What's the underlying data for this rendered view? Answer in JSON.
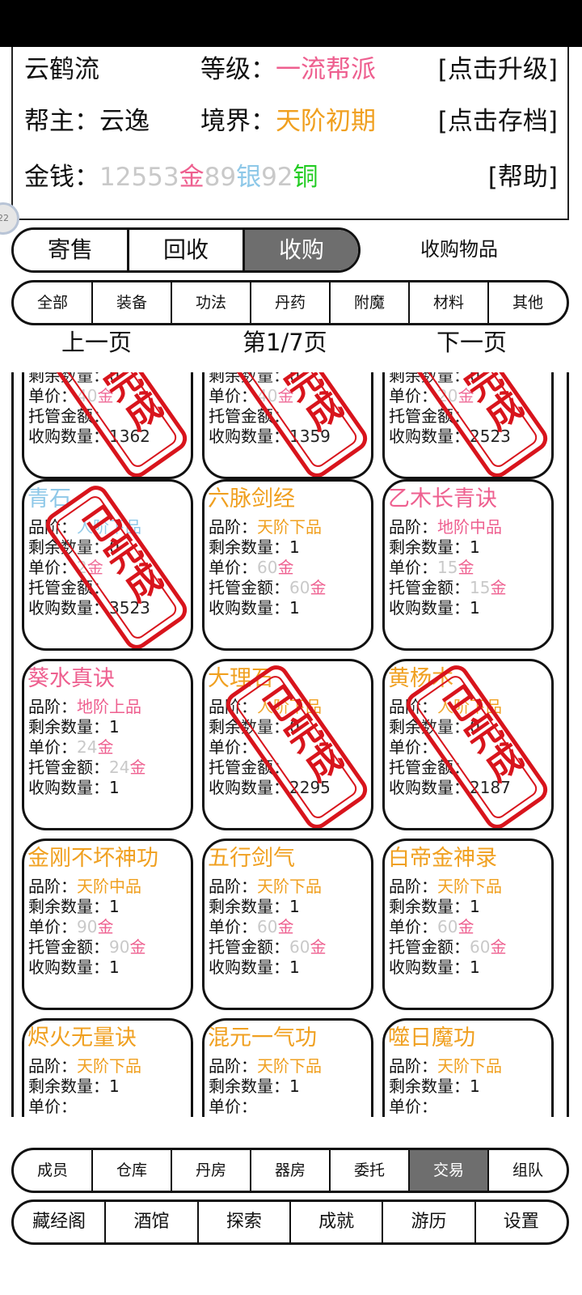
{
  "header": {
    "sect_name": "云鹤流",
    "level_label": "等级：",
    "level_value": "一流帮派",
    "upgrade_btn": "[点击升级]",
    "leader_label": "帮主：云逸",
    "realm_label": "境界：",
    "realm_value": "天阶初期",
    "save_btn": "[点击存档]",
    "money_label": "金钱：",
    "gold_amount": "12553",
    "gold_unit": "金",
    "silver_amount": "89",
    "silver_unit": "银",
    "copper_amount": "92",
    "copper_unit": "铜",
    "help_btn": "[帮助]"
  },
  "float_ball": "22",
  "trade_tabs": [
    "寄售",
    "回收",
    "收购"
  ],
  "trade_caption": "收购物品",
  "filters": [
    "全部",
    "装备",
    "功法",
    "丹药",
    "附魔",
    "材料",
    "其他"
  ],
  "pager": {
    "prev": "上一页",
    "page": "第1/7页",
    "next": "下一页"
  },
  "labels": {
    "grade": "品阶：",
    "remain": "剩余数量：",
    "price": "单价：",
    "deposit": "托管金额：",
    "bought": "收购数量："
  },
  "stamp_text": "已完成",
  "cards": [
    {
      "name": "",
      "grade": "",
      "remain": "0",
      "price": "40",
      "price_unit": "金",
      "deposit": "",
      "deposit_unit": "",
      "bought": "1362"
    },
    {
      "name": "",
      "grade": "",
      "remain": "0",
      "price": "40",
      "price_unit": "金",
      "deposit": "",
      "deposit_unit": "",
      "bought": "1359"
    },
    {
      "name": "",
      "grade": "",
      "remain": "0",
      "price": "20",
      "price_unit": "金",
      "deposit": "",
      "deposit_unit": "",
      "bought": "2523"
    },
    {
      "name": "青石",
      "grade": "人阶下品",
      "remain": "0",
      "price": "2",
      "price_unit": "金",
      "deposit": "",
      "deposit_unit": "",
      "bought": "3523"
    },
    {
      "name": "六脉剑经",
      "grade": "天阶下品",
      "remain": "1",
      "price": "60",
      "price_unit": "金",
      "deposit": "60",
      "deposit_unit": "金",
      "bought": "1"
    },
    {
      "name": "乙木长青诀",
      "grade": "地阶中品",
      "remain": "1",
      "price": "15",
      "price_unit": "金",
      "deposit": "15",
      "deposit_unit": "金",
      "bought": "1"
    },
    {
      "name": "葵水真诀",
      "grade": "地阶上品",
      "remain": "1",
      "price": "24",
      "price_unit": "金",
      "deposit": "24",
      "deposit_unit": "金",
      "bought": "1"
    },
    {
      "name": "大理石",
      "grade": "人阶下品",
      "remain": "0",
      "price": "",
      "price_unit": "",
      "deposit": "",
      "deposit_unit": "",
      "bought": "2295"
    },
    {
      "name": "黄杨木",
      "grade": "人阶下品",
      "remain": "0",
      "price": "",
      "price_unit": "",
      "deposit": "",
      "deposit_unit": "",
      "bought": "2187"
    },
    {
      "name": "金刚不坏神功",
      "grade": "天阶中品",
      "remain": "1",
      "price": "90",
      "price_unit": "金",
      "deposit": "90",
      "deposit_unit": "金",
      "bought": "1"
    },
    {
      "name": "五行剑气",
      "grade": "天阶下品",
      "remain": "1",
      "price": "60",
      "price_unit": "金",
      "deposit": "60",
      "deposit_unit": "金",
      "bought": "1"
    },
    {
      "name": "白帝金神录",
      "grade": "天阶下品",
      "remain": "1",
      "price": "60",
      "price_unit": "金",
      "deposit": "60",
      "deposit_unit": "金",
      "bought": "1"
    },
    {
      "name": "烬火无量诀",
      "grade": "天阶下品",
      "remain": "1",
      "price": "",
      "price_unit": "",
      "deposit": "",
      "deposit_unit": "",
      "bought": ""
    },
    {
      "name": "混元一气功",
      "grade": "天阶下品",
      "remain": "1",
      "price": "",
      "price_unit": "",
      "deposit": "",
      "deposit_unit": "",
      "bought": ""
    },
    {
      "name": "噬日魔功",
      "grade": "天阶下品",
      "remain": "1",
      "price": "",
      "price_unit": "",
      "deposit": "",
      "deposit_unit": "",
      "bought": ""
    }
  ],
  "bottom_nav_1": [
    "成员",
    "仓库",
    "丹房",
    "器房",
    "委托",
    "交易",
    "组队"
  ],
  "bottom_nav_2": [
    "藏经阁",
    "酒馆",
    "探索",
    "成就",
    "游历",
    "设置"
  ],
  "colors": {
    "pink": "#ee5f8f",
    "orange": "#f0a020",
    "blue": "#8ec8e8",
    "green": "#22cc22",
    "stamp_red": "#d8141c",
    "active_gray": "#6e6e6e"
  }
}
